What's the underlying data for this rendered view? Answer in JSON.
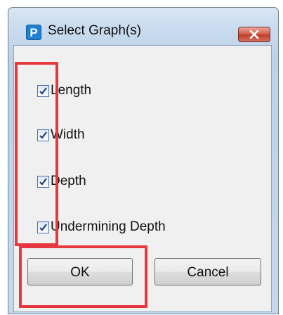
{
  "window": {
    "title": "Select Graph(s)",
    "app_icon_letter": "P"
  },
  "checkboxes": [
    {
      "label": "Length",
      "checked": true
    },
    {
      "label": "Width",
      "checked": true
    },
    {
      "label": "Depth",
      "checked": true
    },
    {
      "label": "Undermining Depth",
      "checked": true
    }
  ],
  "buttons": {
    "ok_label": "OK",
    "cancel_label": "Cancel"
  },
  "colors": {
    "highlight": "#e8383f",
    "title_gradient_top": "#d9e6f3",
    "close_button": "#c23d2b",
    "client_background": "#f0f0f0"
  },
  "icons": {
    "app": "p-app-icon",
    "close": "close-icon",
    "check": "checkmark-icon"
  }
}
